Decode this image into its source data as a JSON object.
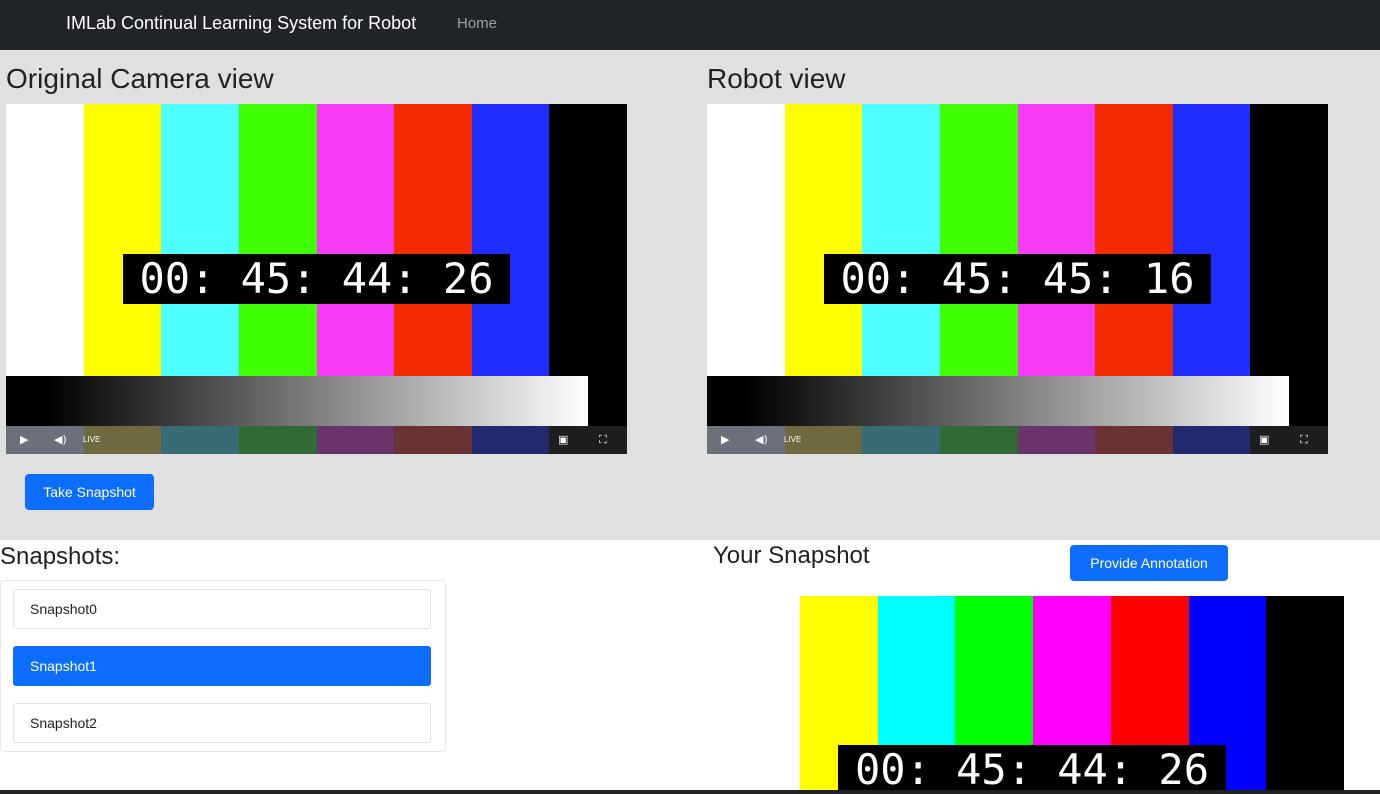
{
  "navbar": {
    "brand": "IMLab Continual Learning System for Robot",
    "home_link": "Home"
  },
  "original_view": {
    "title": "Original Camera view",
    "timecode": "00: 45: 44: 26",
    "live_label": "LIVE"
  },
  "robot_view": {
    "title": "Robot view",
    "timecode": "00: 45: 45: 16",
    "live_label": "LIVE"
  },
  "take_snapshot_label": "Take Snapshot",
  "snapshots": {
    "title": "Snapshots:",
    "items": [
      {
        "label": "Snapshot0"
      },
      {
        "label": "Snapshot1"
      },
      {
        "label": "Snapshot2"
      }
    ],
    "selected_index": 1
  },
  "your_snapshot": {
    "title": "Your Snapshot",
    "annotate_label": "Provide Annotation",
    "timecode": "00: 45: 44: 26"
  },
  "test_pattern": {
    "bar_colors": [
      "#ffffff",
      "#ffff00",
      "#4dffff",
      "#3fff00",
      "#f53bf5",
      "#f52b00",
      "#1f2eff",
      "#000000"
    ],
    "control_bar_colors": [
      "#6b7079",
      "#6d6a40",
      "#396b77",
      "#306b37",
      "#68346b",
      "#6b3233",
      "#222a6e",
      "#1e1e1e"
    ],
    "snapshot_bar_colors": [
      "#ffff00",
      "#00ffff",
      "#00ff00",
      "#ff00ff",
      "#ff0000",
      "#0000ff",
      "#000000"
    ]
  },
  "icons": {
    "play": "play-icon",
    "volume": "volume-icon",
    "pip": "picture-in-picture-icon",
    "fullscreen": "fullscreen-icon"
  }
}
